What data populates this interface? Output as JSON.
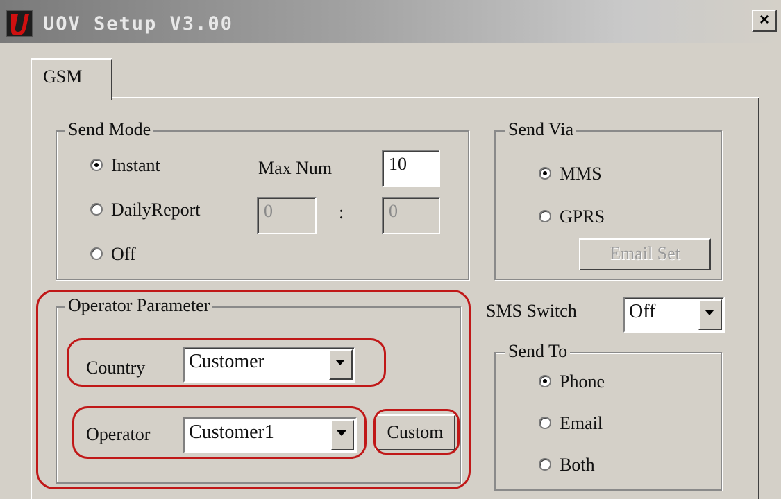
{
  "window": {
    "title": "UOV Setup V3.00",
    "close_label": "×"
  },
  "tabs": [
    {
      "label": "GSM",
      "active": true
    }
  ],
  "send_mode": {
    "legend": "Send Mode",
    "options": [
      {
        "label": "Instant",
        "selected": true
      },
      {
        "label": "DailyReport",
        "selected": false
      },
      {
        "label": "Off",
        "selected": false
      }
    ],
    "max_num_label": "Max Num",
    "max_num_value": "10",
    "daily_hour": "0",
    "daily_separator": ":",
    "daily_minute": "0"
  },
  "send_via": {
    "legend": "Send Via",
    "options": [
      {
        "label": "MMS",
        "selected": true
      },
      {
        "label": "GPRS",
        "selected": false
      }
    ],
    "email_set_label": "Email Set"
  },
  "sms_switch": {
    "label": "SMS Switch",
    "value": "Off"
  },
  "operator_parameter": {
    "legend": "Operator Parameter",
    "country_label": "Country",
    "country_value": "Customer",
    "operator_label": "Operator",
    "operator_value": "Customer1",
    "custom_label": "Custom"
  },
  "send_to": {
    "legend": "Send To",
    "options": [
      {
        "label": "Phone",
        "selected": true
      },
      {
        "label": "Email",
        "selected": false
      },
      {
        "label": "Both",
        "selected": false
      }
    ]
  },
  "colors": {
    "dialog_bg": "#d4d0c8",
    "annotation_red": "#c01818"
  }
}
